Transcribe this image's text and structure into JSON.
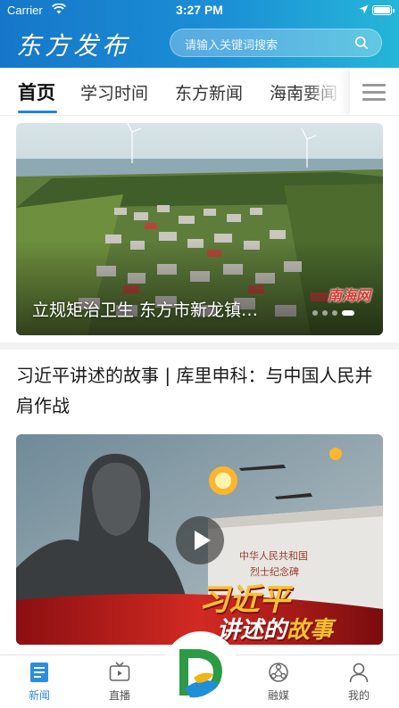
{
  "status_bar": {
    "carrier": "Carrier",
    "time": "3:27 PM"
  },
  "header": {
    "logo_text": "东方发布",
    "search_placeholder": "请输入关键词搜索"
  },
  "tabs": [
    {
      "label": "首页",
      "active": true
    },
    {
      "label": "学习时间",
      "active": false
    },
    {
      "label": "东方新闻",
      "active": false
    },
    {
      "label": "海南要闻",
      "active": false
    }
  ],
  "banner": {
    "caption": "立规矩治卫生 东方市新龙镇…",
    "watermark": "南海网",
    "slide_count": 4,
    "active_slide": 3
  },
  "article": {
    "title": "习近平讲述的故事 | 库里申科：与中国人民并肩作战",
    "video_overlay_line1": "习近平",
    "video_overlay_line2a": "讲述的",
    "video_overlay_line2b": "故事"
  },
  "bottom_nav": [
    {
      "label": "新闻",
      "icon": "news-icon",
      "active": true
    },
    {
      "label": "直播",
      "icon": "tv-icon",
      "active": false
    },
    {
      "label": "融媒",
      "icon": "media-hub-icon",
      "active": false
    },
    {
      "label": "我的",
      "icon": "user-icon",
      "active": false
    }
  ],
  "colors": {
    "header_start": "#1677c9",
    "header_end": "#25b6d8",
    "accent": "#2385d6",
    "nav_active": "#2a8de0"
  }
}
